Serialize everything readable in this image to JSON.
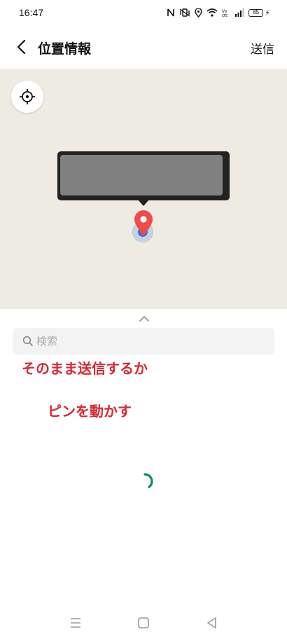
{
  "status_bar": {
    "time": "16:47",
    "icons": [
      "nfc-icon",
      "vibrate-icon",
      "location-icon",
      "wifi-icon",
      "volte-icon",
      "signal-icon"
    ],
    "battery": "85",
    "charging": true
  },
  "header": {
    "title": "位置情報",
    "send_label": "送信"
  },
  "map": {
    "background_color": "#eeebe3",
    "address_redacted": true,
    "pin_color": "#ef4b4b"
  },
  "sheet": {
    "search_placeholder": "検索",
    "annotation_1": "そのまま送信するか",
    "annotation_2": "ピンを動かす",
    "annotation_color": "#d9282f",
    "loading": true
  },
  "navbar": {
    "buttons": [
      "menu-icon",
      "home-icon",
      "back-icon"
    ]
  }
}
